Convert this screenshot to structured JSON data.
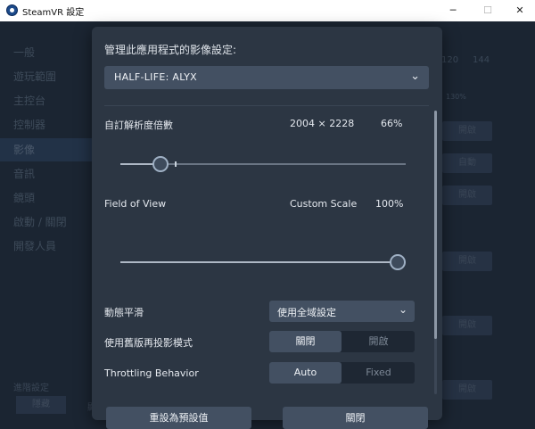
{
  "window": {
    "title": "SteamVR 設定",
    "min_glyph": "─",
    "max_glyph": "☐",
    "close_glyph": "✕"
  },
  "sidebar": {
    "items": [
      {
        "label": "一般"
      },
      {
        "label": "遊玩範圍"
      },
      {
        "label": "主控台"
      },
      {
        "label": "控制器"
      },
      {
        "label": "影像"
      },
      {
        "label": "音訊"
      },
      {
        "label": "鏡頭"
      },
      {
        "label": "啟動 / 關閉"
      },
      {
        "label": "開發人員"
      }
    ],
    "footer_label": "進階設定",
    "footer_chip": "隱藏",
    "footer_extra": "顯"
  },
  "background": {
    "hz_a": "120",
    "hz_b": "144",
    "pct": "130%",
    "btn_labels": [
      "開啟",
      "自動",
      "開啟",
      "開啟",
      "開啟",
      "開啟"
    ]
  },
  "dialog": {
    "title": "管理此應用程式的影像設定:",
    "game": "HALF-LIFE: ALYX",
    "resolution": {
      "label": "自訂解析度倍數",
      "dims": "2004 × 2228",
      "percent": "66%",
      "value_fraction": 0.12,
      "marker_fraction": 0.19
    },
    "fov": {
      "label": "Field of View",
      "mode": "Custom Scale",
      "percent": "100%",
      "value_fraction": 1.0
    },
    "motion_smoothing": {
      "label": "動態平滑",
      "value": "使用全域設定"
    },
    "legacy_reprojection": {
      "label": "使用舊版再投影模式",
      "options": [
        "關閉",
        "開啟"
      ],
      "selected": "關閉"
    },
    "throttling": {
      "label": "Throttling Behavior",
      "options": [
        "Auto",
        "Fixed"
      ],
      "selected": "Auto"
    },
    "reset_label": "重設為預設值",
    "close_label": "關閉"
  }
}
